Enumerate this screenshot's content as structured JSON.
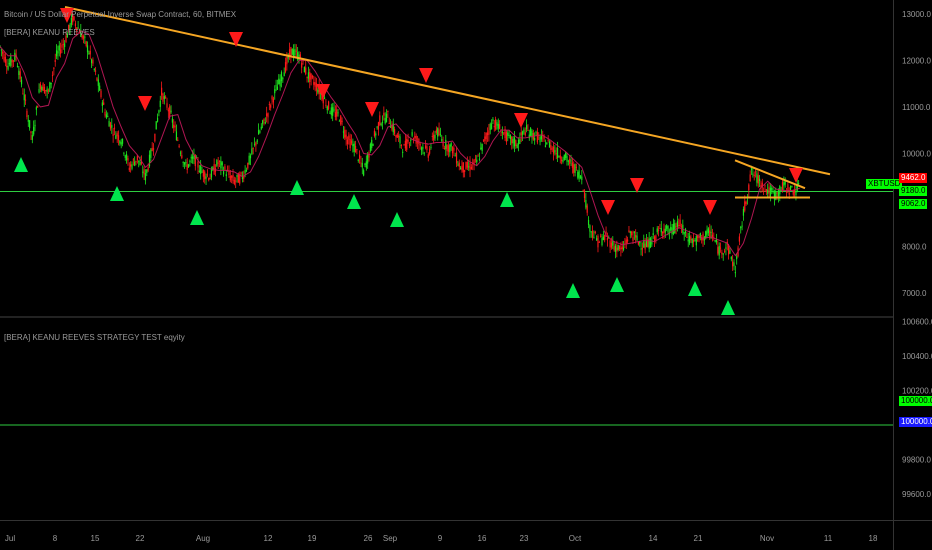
{
  "header": {
    "symbol_title": "Bitcoin / US Dollar Perpetual Inverse Swap Contract, 60, BITMEX",
    "indicator_label": "[BERA] KEANU REEVES",
    "equity_label": "[BERA] KEANU REEVES STRATEGY TEST eqyity"
  },
  "price_axis": {
    "ticks": [
      "13000.0",
      "12000.0",
      "11000.0",
      "10000.0",
      "8000.0",
      "7000.0"
    ],
    "tick_values": [
      13000,
      12000,
      11000,
      10000,
      8000,
      7000
    ],
    "ymin": 6500,
    "ymax": 13300
  },
  "price_badges": {
    "symbol_tag": "XBTUSD",
    "last_price": "9462.0",
    "level_1": "9180.0",
    "level_2": "9062.0"
  },
  "equity_axis": {
    "ticks": [
      "100600.0",
      "100400.0",
      "100200.0",
      "99800.0",
      "99600.0"
    ],
    "tick_values": [
      100600,
      100400,
      100200,
      99800,
      99600
    ],
    "ymin": 99450,
    "ymax": 100620,
    "badge_top": "100000.0",
    "badge_bottom": "100000.0",
    "equity_value": 100000
  },
  "time_axis": {
    "labels": [
      "Jul",
      "8",
      "15",
      "22",
      "Aug",
      "12",
      "19",
      "26",
      "Sep",
      "9",
      "16",
      "23",
      "Oct",
      "14",
      "21",
      "Nov",
      "11",
      "18"
    ]
  },
  "colors": {
    "background": "#000000",
    "bull": "#1ee51e",
    "bear": "#ff1a1a",
    "trendline": "#f5a623",
    "support_line": "#2ecc40",
    "buy_arrow": "#00e64d",
    "sell_arrow": "#ff1a1a",
    "badge_green": "#00ff00",
    "badge_red": "#ff0000",
    "badge_blue": "#1a1aff"
  },
  "chart_data": {
    "type": "line",
    "ylim": [
      6500,
      13300
    ],
    "series": [
      {
        "values": [
          12300,
          11900,
          12100,
          11200,
          10300,
          11500,
          11300,
          12100,
          12400,
          12900,
          12600,
          12200,
          11600,
          10900,
          10500,
          10300,
          9700,
          9900,
          9500,
          10200,
          11300,
          10900,
          10300,
          9700,
          9900,
          9600,
          9500,
          9800,
          9600,
          9400,
          9500,
          9900,
          10400,
          10800,
          11300,
          11700,
          12200,
          12100,
          11700,
          11500,
          11200,
          10900,
          10800,
          10300,
          10100,
          9600,
          10200,
          10700,
          10800,
          10400,
          10100,
          10400,
          10200,
          10000,
          10500,
          10200,
          10100,
          9700,
          9700,
          9800,
          10300,
          10700,
          10500,
          10300,
          10200,
          10500,
          10400,
          10300,
          10200,
          10000,
          9900,
          9700,
          9500,
          8400,
          8100,
          8200,
          8000,
          7900,
          8300,
          8100,
          8000,
          8200,
          8400,
          8300,
          8500,
          8200,
          8100,
          8200,
          8300,
          7900,
          8000,
          7500,
          8700,
          9600,
          9400,
          9200,
          9100,
          9300,
          9200,
          9250
        ]
      }
    ]
  }
}
